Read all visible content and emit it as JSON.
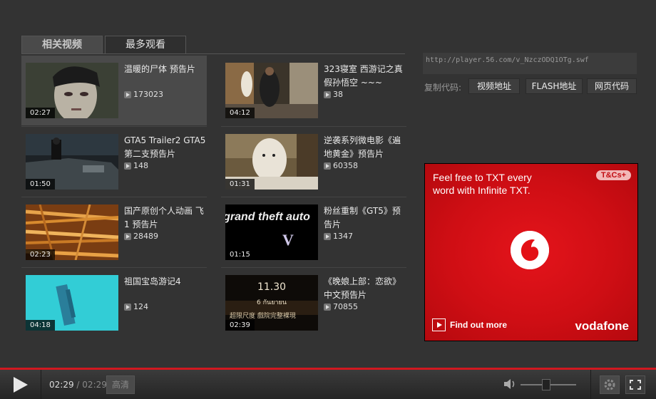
{
  "tabs": {
    "related": "相关视频",
    "most_viewed": "最多观看"
  },
  "videos": [
    {
      "title": "温暖的尸体 预告片",
      "duration": "02:27",
      "views": "173023"
    },
    {
      "title": "323寝室 西游记之真假孙悟空 ~~~",
      "duration": "04:12",
      "views": "38"
    },
    {
      "title": "GTA5 Trailer2 GTA5第二支预告片",
      "duration": "01:50",
      "views": "148"
    },
    {
      "title": "逆袭系列微电影《遍地黄金》预告片",
      "duration": "01:31",
      "views": "60358"
    },
    {
      "title": "国产原创个人动画 飞 1 预告片",
      "duration": "02:23",
      "views": "28489"
    },
    {
      "title": "粉丝重制《GT5》预告片",
      "duration": "01:15",
      "views": "1347"
    },
    {
      "title": "祖国宝岛游记4",
      "duration": "04:18",
      "views": "124"
    },
    {
      "title": "《晚娘上部：恋欲》中文预告片",
      "duration": "02:39",
      "views": "70855"
    }
  ],
  "thumb_overlays": {
    "gta_logo": "grand theft auto",
    "gta_numeral": "V",
    "movie_date": "11.30",
    "movie_sub": "6 กันยายน",
    "movie_tagline": "超限尺度 戲院完整裸現"
  },
  "share": {
    "url": "http://player.56.com/v_NzczODQ1OTg.swf",
    "copy_label": "复制代码:",
    "btn_video": "视频地址",
    "btn_flash": "FLASH地址",
    "btn_page": "网页代码"
  },
  "ad": {
    "line1": "Feel free to TXT every",
    "line2": "word with Infinite TXT.",
    "tcs": "T&Cs+",
    "find_more": "Find out more",
    "brand": "vodafone",
    "bg_color": "#cf0e14"
  },
  "player": {
    "current_time": "02:29",
    "separator": "/",
    "total_time": "02:29",
    "hd_label": "高清",
    "progress": 1.0,
    "volume": 0.4,
    "accent": "#d11820"
  }
}
